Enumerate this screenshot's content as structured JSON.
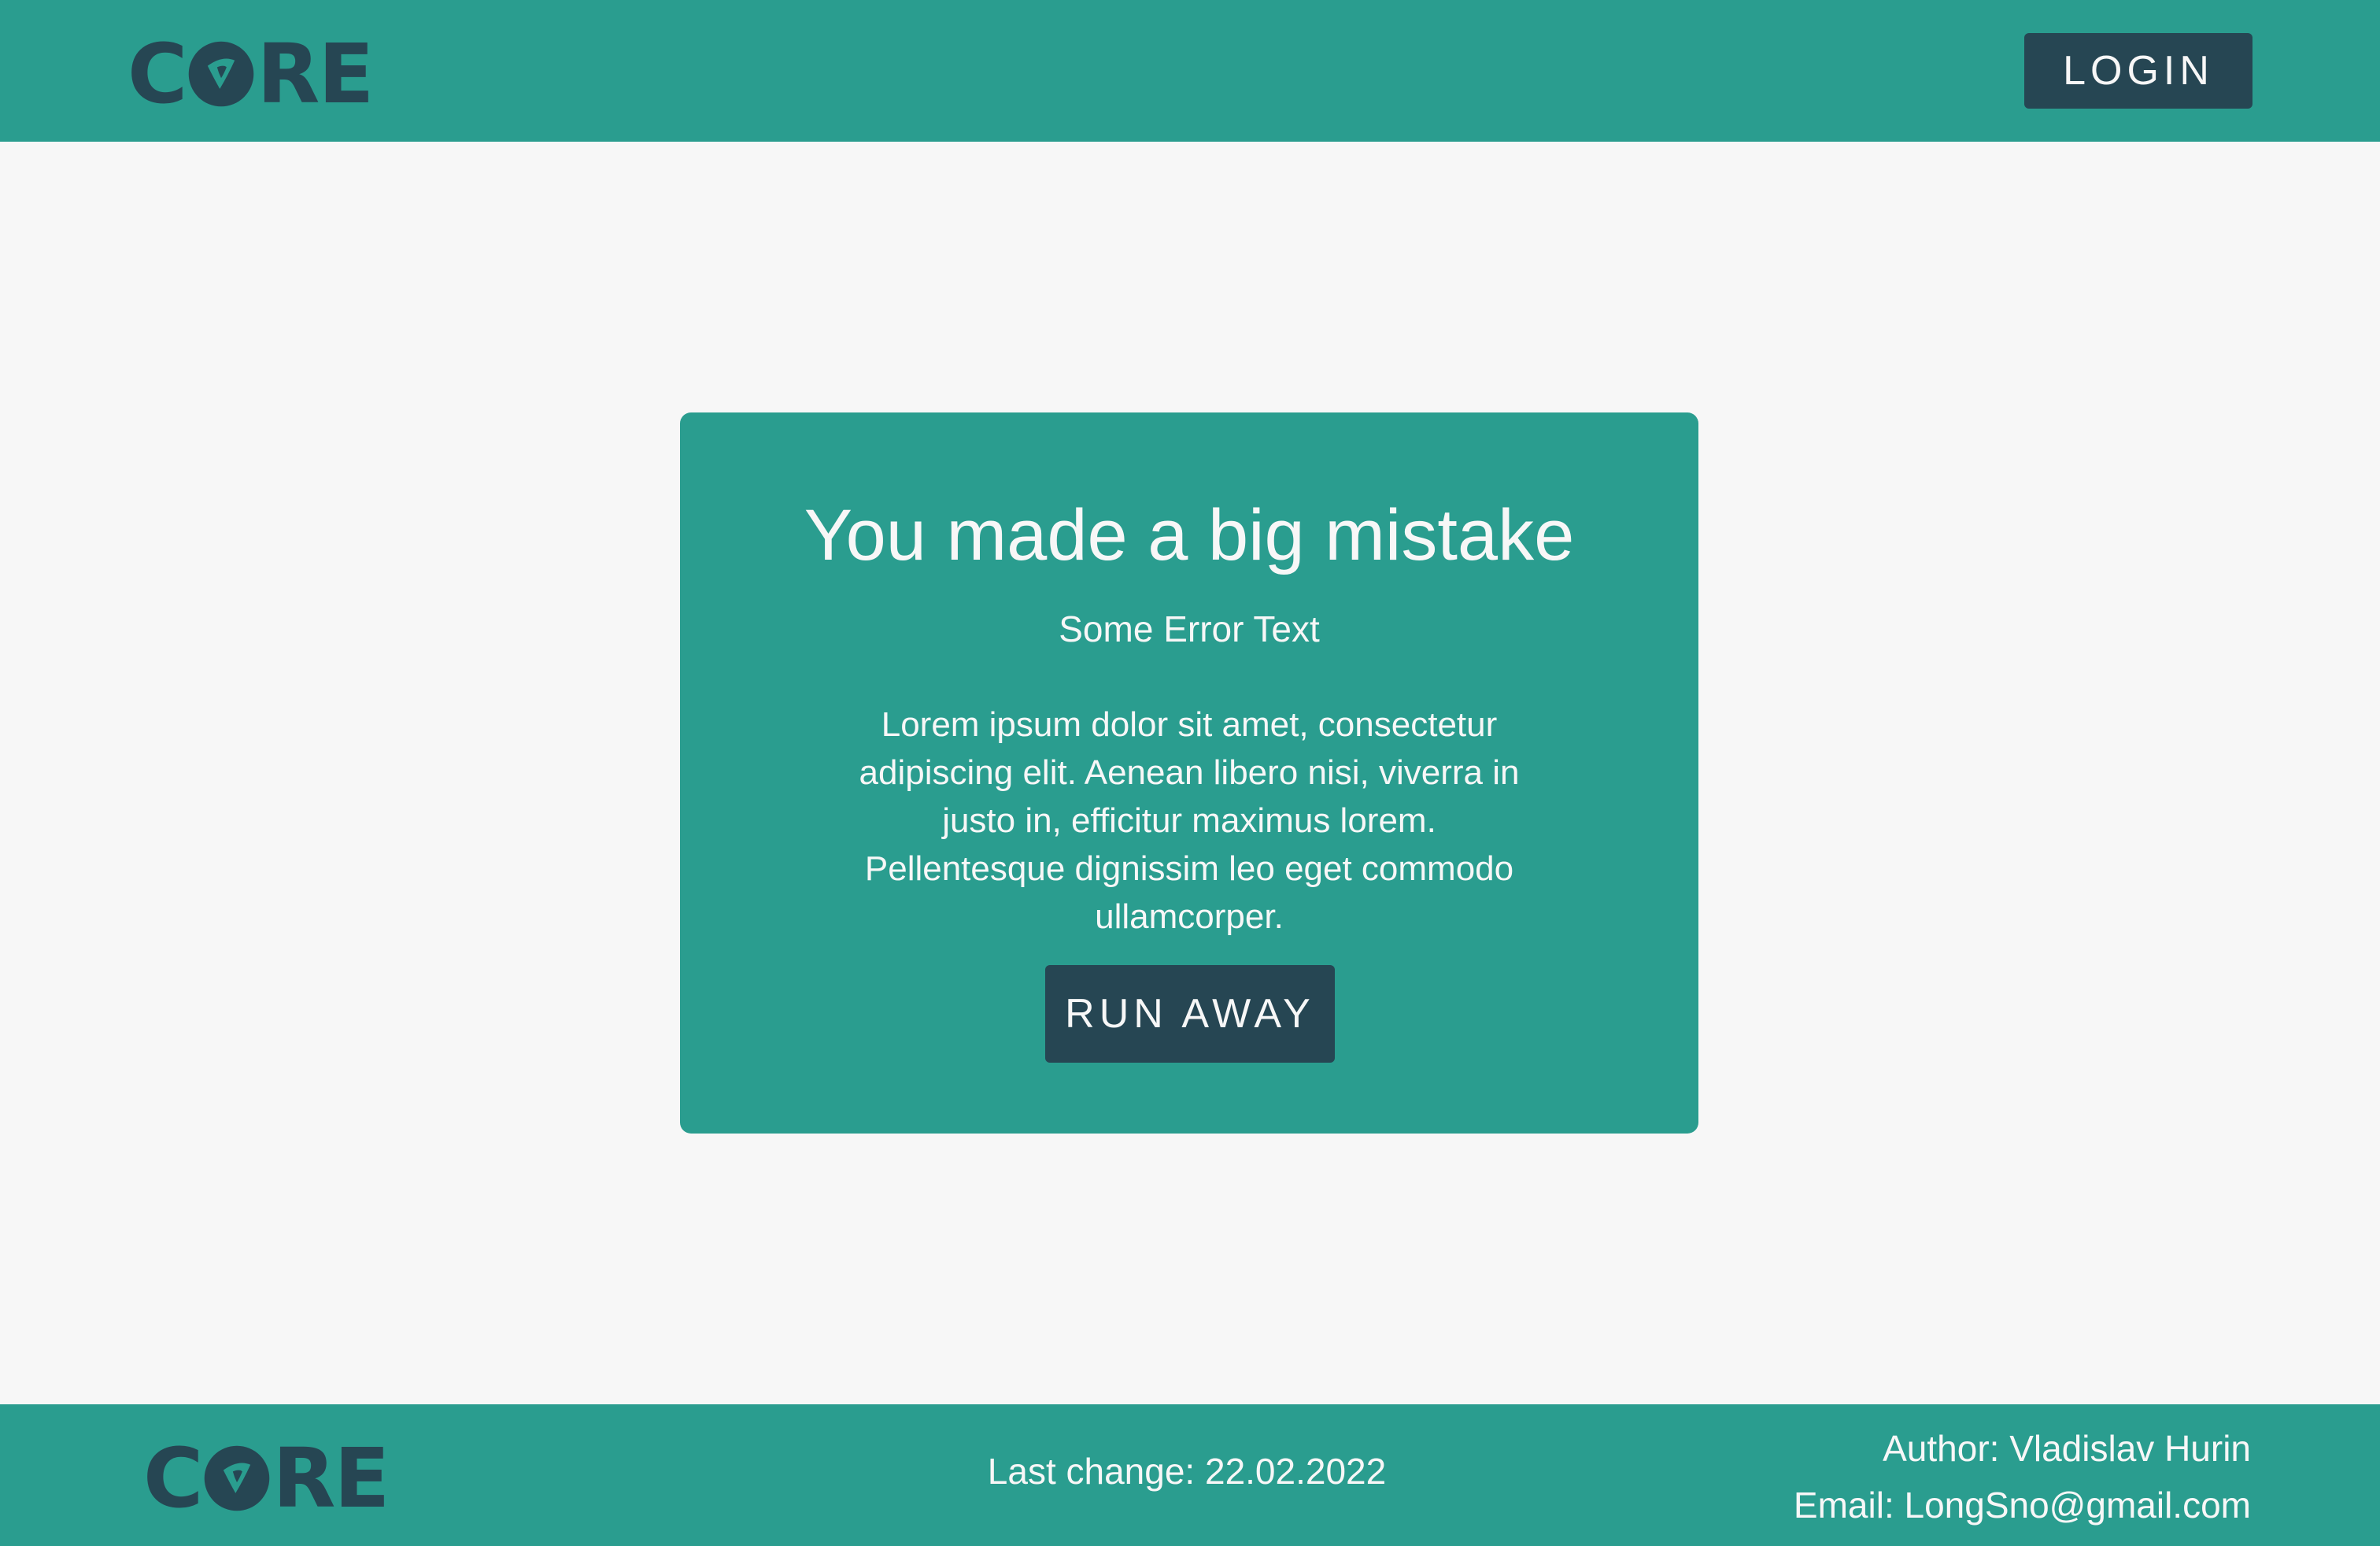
{
  "header": {
    "logo": {
      "part1": "C",
      "part2": "RE",
      "icon": "core-o-logo-icon"
    },
    "login_label": "LOGIN"
  },
  "card": {
    "title": "You made a big mistake",
    "subtitle": "Some Error Text",
    "body": "Lorem ipsum dolor sit amet, consectetur adipiscing elit. Aenean libero nisi, viverra in justo in, efficitur maximus lorem. Pellentesque dignissim leo eget commodo ullamcorper.",
    "button_label": "RUN AWAY"
  },
  "footer": {
    "logo": {
      "part1": "C",
      "part2": "RE",
      "icon": "core-o-logo-icon"
    },
    "last_change": "Last change: 22.02.2022",
    "author": "Author: Vladislav Hurin",
    "email": "Email: LongSno@gmail.com"
  },
  "colors": {
    "primary": "#2a9d8f",
    "dark": "#264653",
    "background": "#f7f7f7",
    "text_light": "#f7f7f7"
  }
}
